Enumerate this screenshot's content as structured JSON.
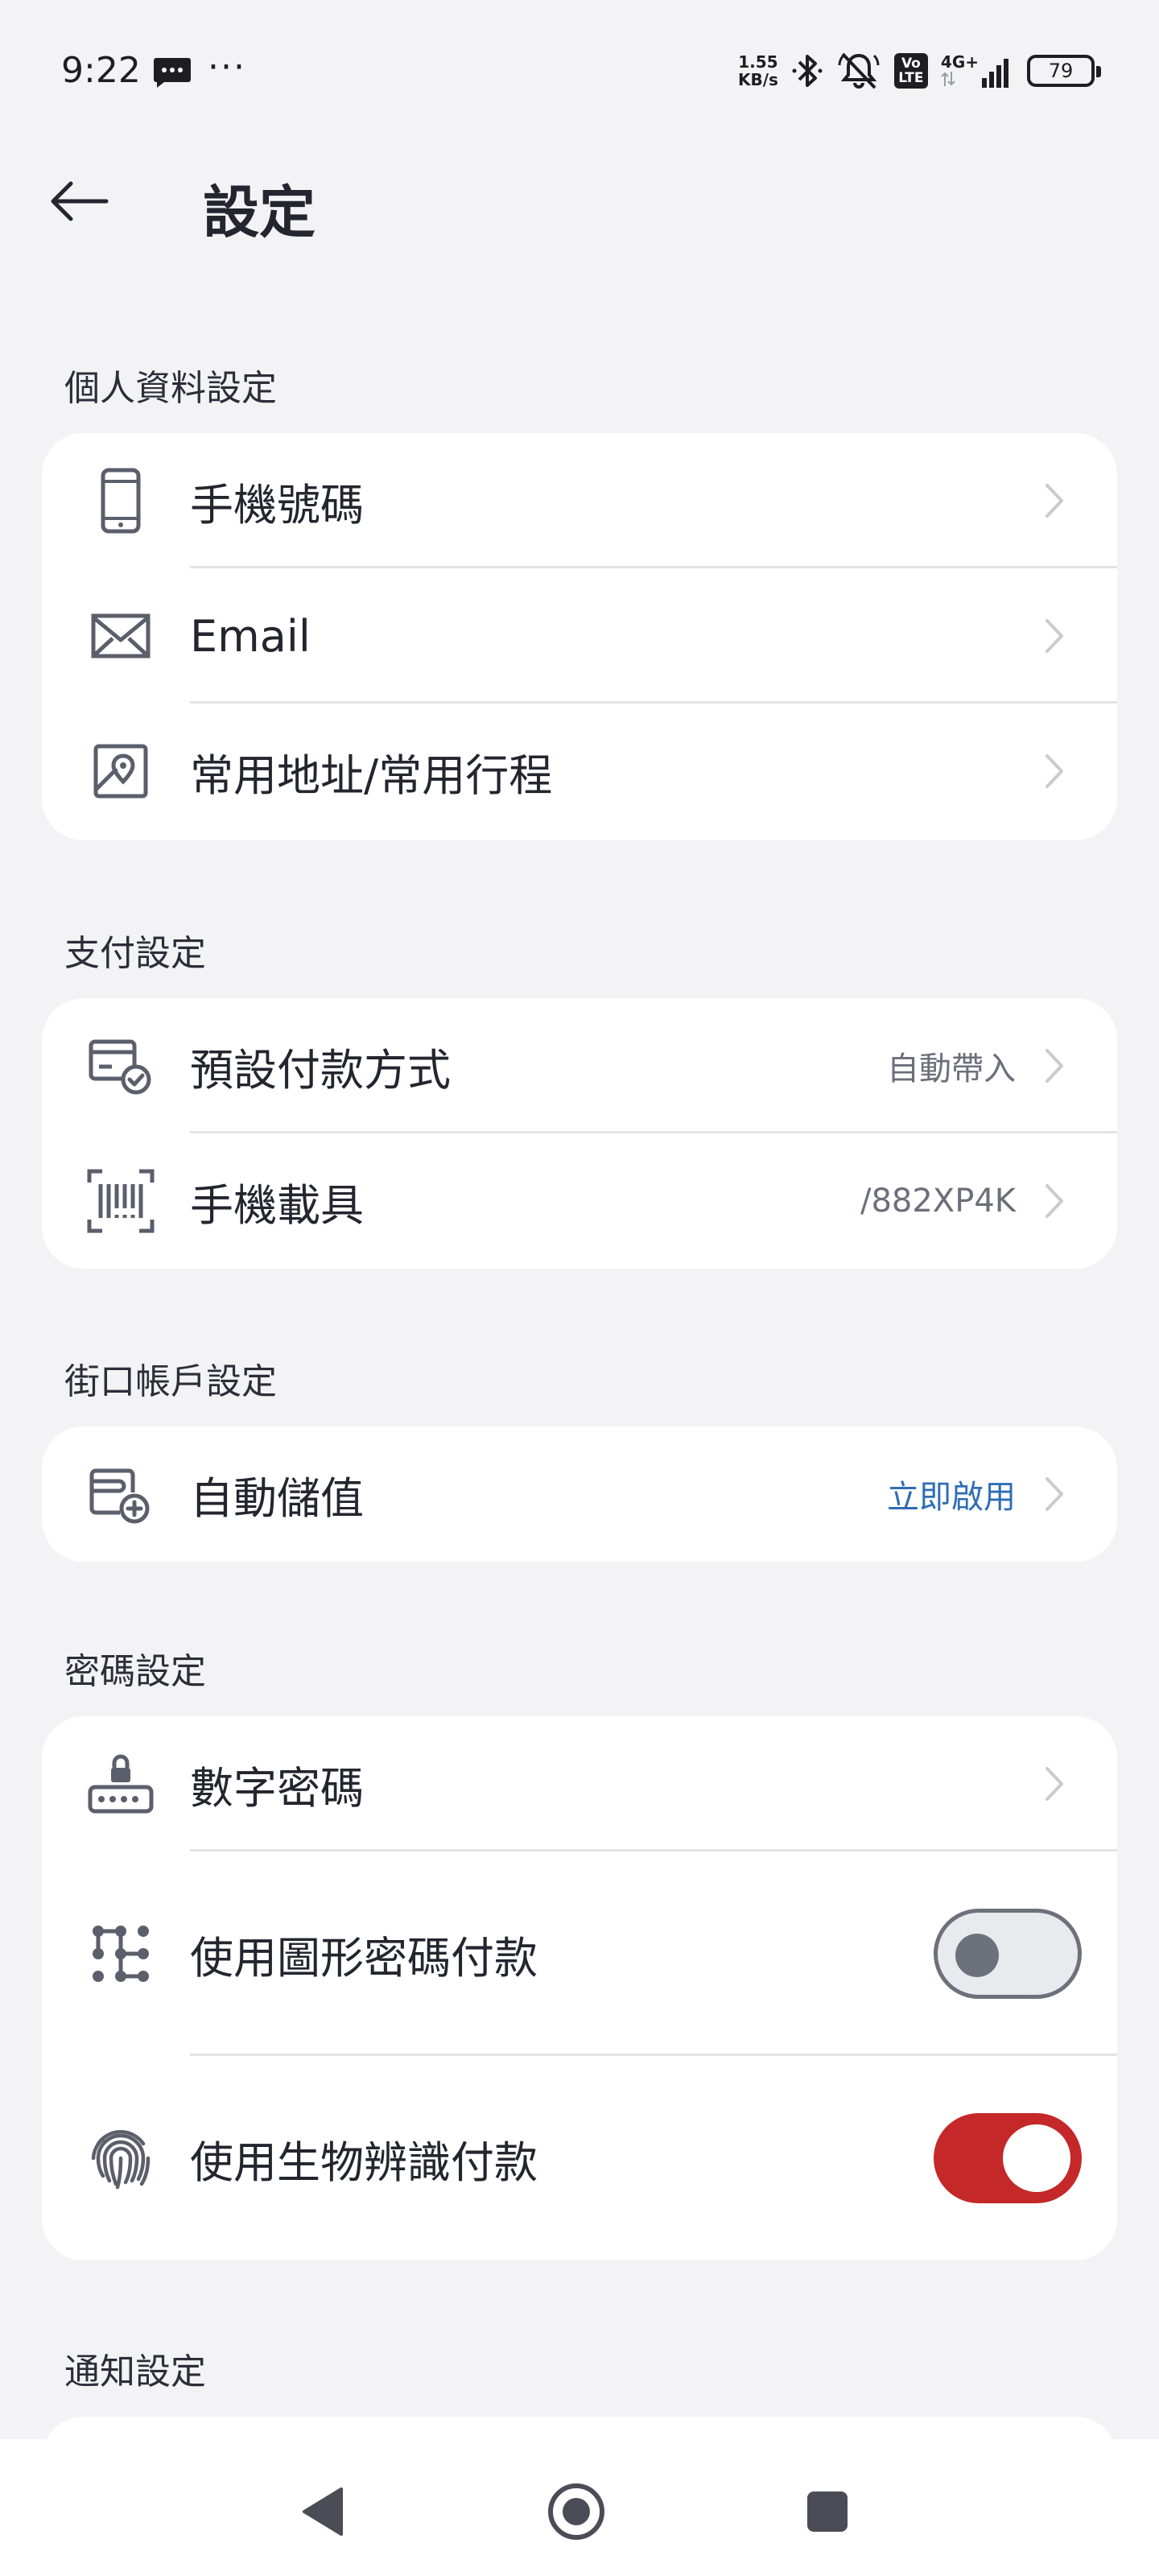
{
  "status_bar": {
    "time": "9:22",
    "more": "···",
    "net_speed_value": "1.55",
    "net_speed_unit": "KB/s",
    "volte": "Vo LTE",
    "network": "4G+",
    "battery": "79"
  },
  "header": {
    "title": "設定"
  },
  "sections": {
    "personal": {
      "label": "個人資料設定",
      "items": [
        {
          "label": "手機號碼",
          "icon": "phone-icon"
        },
        {
          "label": "Email",
          "icon": "mail-icon"
        },
        {
          "label": "常用地址/常用行程",
          "icon": "map-pin-icon"
        }
      ]
    },
    "payment": {
      "label": "支付設定",
      "items": [
        {
          "label": "預設付款方式",
          "value": "自動帶入",
          "icon": "card-check-icon"
        },
        {
          "label": "手機載具",
          "value": "/882XP4K",
          "icon": "barcode-icon"
        }
      ]
    },
    "account": {
      "label": "街口帳戶設定",
      "items": [
        {
          "label": "自動儲值",
          "value": "立即啟用",
          "icon": "wallet-plus-icon"
        }
      ]
    },
    "password": {
      "label": "密碼設定",
      "items": [
        {
          "label": "數字密碼",
          "icon": "keypad-lock-icon"
        },
        {
          "label": "使用圖形密碼付款",
          "icon": "pattern-icon",
          "toggle_on": false
        },
        {
          "label": "使用生物辨識付款",
          "icon": "fingerprint-icon",
          "toggle_on": true
        }
      ]
    },
    "notify": {
      "label": "通知設定"
    }
  },
  "colors": {
    "accent": "#c42828",
    "link": "#2f6db5",
    "background": "#f3f3f5"
  }
}
